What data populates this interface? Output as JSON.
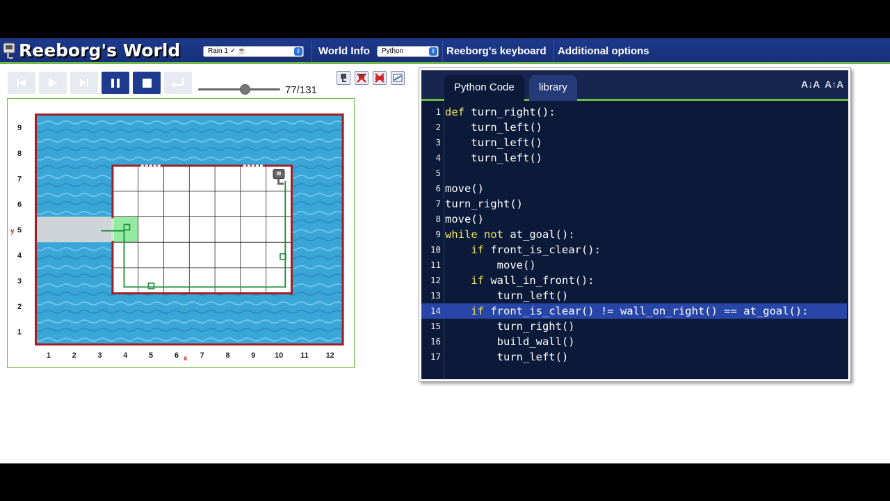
{
  "app": {
    "title": "Reeborg's World",
    "world_select": "Rain 1 ✓ ☕",
    "world_info": "World Info",
    "language_select": "Python",
    "keyboard": "Reeborg's keyboard",
    "additional": "Additional options"
  },
  "controls": {
    "step_counter": "77/131",
    "slider_fraction": 0.58
  },
  "world": {
    "x_label": "x",
    "y_label": "y",
    "x_ticks": [
      "1",
      "2",
      "3",
      "4",
      "5",
      "6",
      "7",
      "8",
      "9",
      "10",
      "11",
      "12"
    ],
    "y_ticks": [
      "9",
      "8",
      "7",
      "6",
      "5",
      "4",
      "3",
      "2",
      "1"
    ],
    "colors": {
      "wall": "#a01f24",
      "grid": "#222222",
      "trace": "#1a8a3a",
      "home": "#7fe88f",
      "water": "#3aa6d8"
    }
  },
  "editor": {
    "tabs": [
      "Python Code",
      "library"
    ],
    "font_smaller": "A↓A",
    "font_larger": "A↑A",
    "highlighted_line": 14,
    "lines": [
      {
        "n": "1",
        "code": "def turn_right():"
      },
      {
        "n": "2",
        "code": "    turn_left()"
      },
      {
        "n": "3",
        "code": "    turn_left()"
      },
      {
        "n": "4",
        "code": "    turn_left()"
      },
      {
        "n": "5",
        "code": ""
      },
      {
        "n": "6",
        "code": "move()"
      },
      {
        "n": "7",
        "code": "turn_right()"
      },
      {
        "n": "8",
        "code": "move()"
      },
      {
        "n": "9",
        "code": "while not at_goal():"
      },
      {
        "n": "10",
        "code": "    if front_is_clear():"
      },
      {
        "n": "11",
        "code": "        move()"
      },
      {
        "n": "12",
        "code": "    if wall_in_front():"
      },
      {
        "n": "13",
        "code": "        turn_left()"
      },
      {
        "n": "14",
        "code": "    if front_is_clear() != wall_on_right() == at_goal():"
      },
      {
        "n": "15",
        "code": "        turn_right()"
      },
      {
        "n": "16",
        "code": "        build_wall()"
      },
      {
        "n": "17",
        "code": "        turn_left()"
      }
    ]
  }
}
